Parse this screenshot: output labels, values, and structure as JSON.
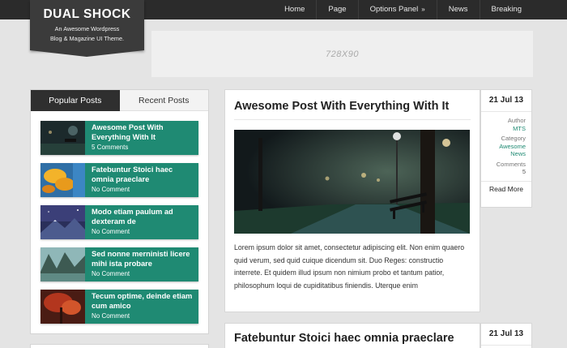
{
  "nav": {
    "items": [
      "Home",
      "Page",
      "Options Panel",
      "News",
      "Breaking"
    ],
    "options_caret": "»"
  },
  "logo": {
    "title": "DUAL SHOCK",
    "tagline_1": "An Awesome Wordpress",
    "tagline_2": "Blog & Magazine UI Theme."
  },
  "ad": {
    "label": "728X90"
  },
  "sidebar": {
    "tabs": [
      "Popular Posts",
      "Recent Posts"
    ],
    "active_tab": "Popular Posts",
    "accent_color": "#1f8a73",
    "posts": [
      {
        "title": "Awesome Post With Everything With It",
        "meta": "5 Comments"
      },
      {
        "title": "Fatebuntur Stoici haec omnia praeclare",
        "meta": "No Comment"
      },
      {
        "title": "Modo etiam paulum ad dexteram de",
        "meta": "No Comment"
      },
      {
        "title": "Sed nonne merninisti licere mihi ista probare",
        "meta": "No Comment"
      },
      {
        "title": "Tecum optime, deinde etiam cum amico",
        "meta": "No Comment"
      }
    ]
  },
  "articles": [
    {
      "title": "Awesome Post With Everything With It",
      "excerpt": "Lorem ipsum dolor sit amet, consectetur adipiscing elit. Non enim quaero quid verum, sed quid cuique dicendum sit. Duo Reges: constructio interrete. Et quidem illud ipsum non nimium probo et tantum patior, philosophum loqui de cupiditatibus finiendis. Uterque enim",
      "date": "21 Jul 13",
      "author_label": "Author",
      "author": "MTS",
      "category_label": "Category",
      "category_1": "Awesome",
      "category_2": "News",
      "comments_label": "Comments",
      "comments": "5",
      "read_more": "Read More"
    },
    {
      "title": "Fatebuntur Stoici haec omnia praeclare",
      "date": "21 Jul 13"
    }
  ]
}
